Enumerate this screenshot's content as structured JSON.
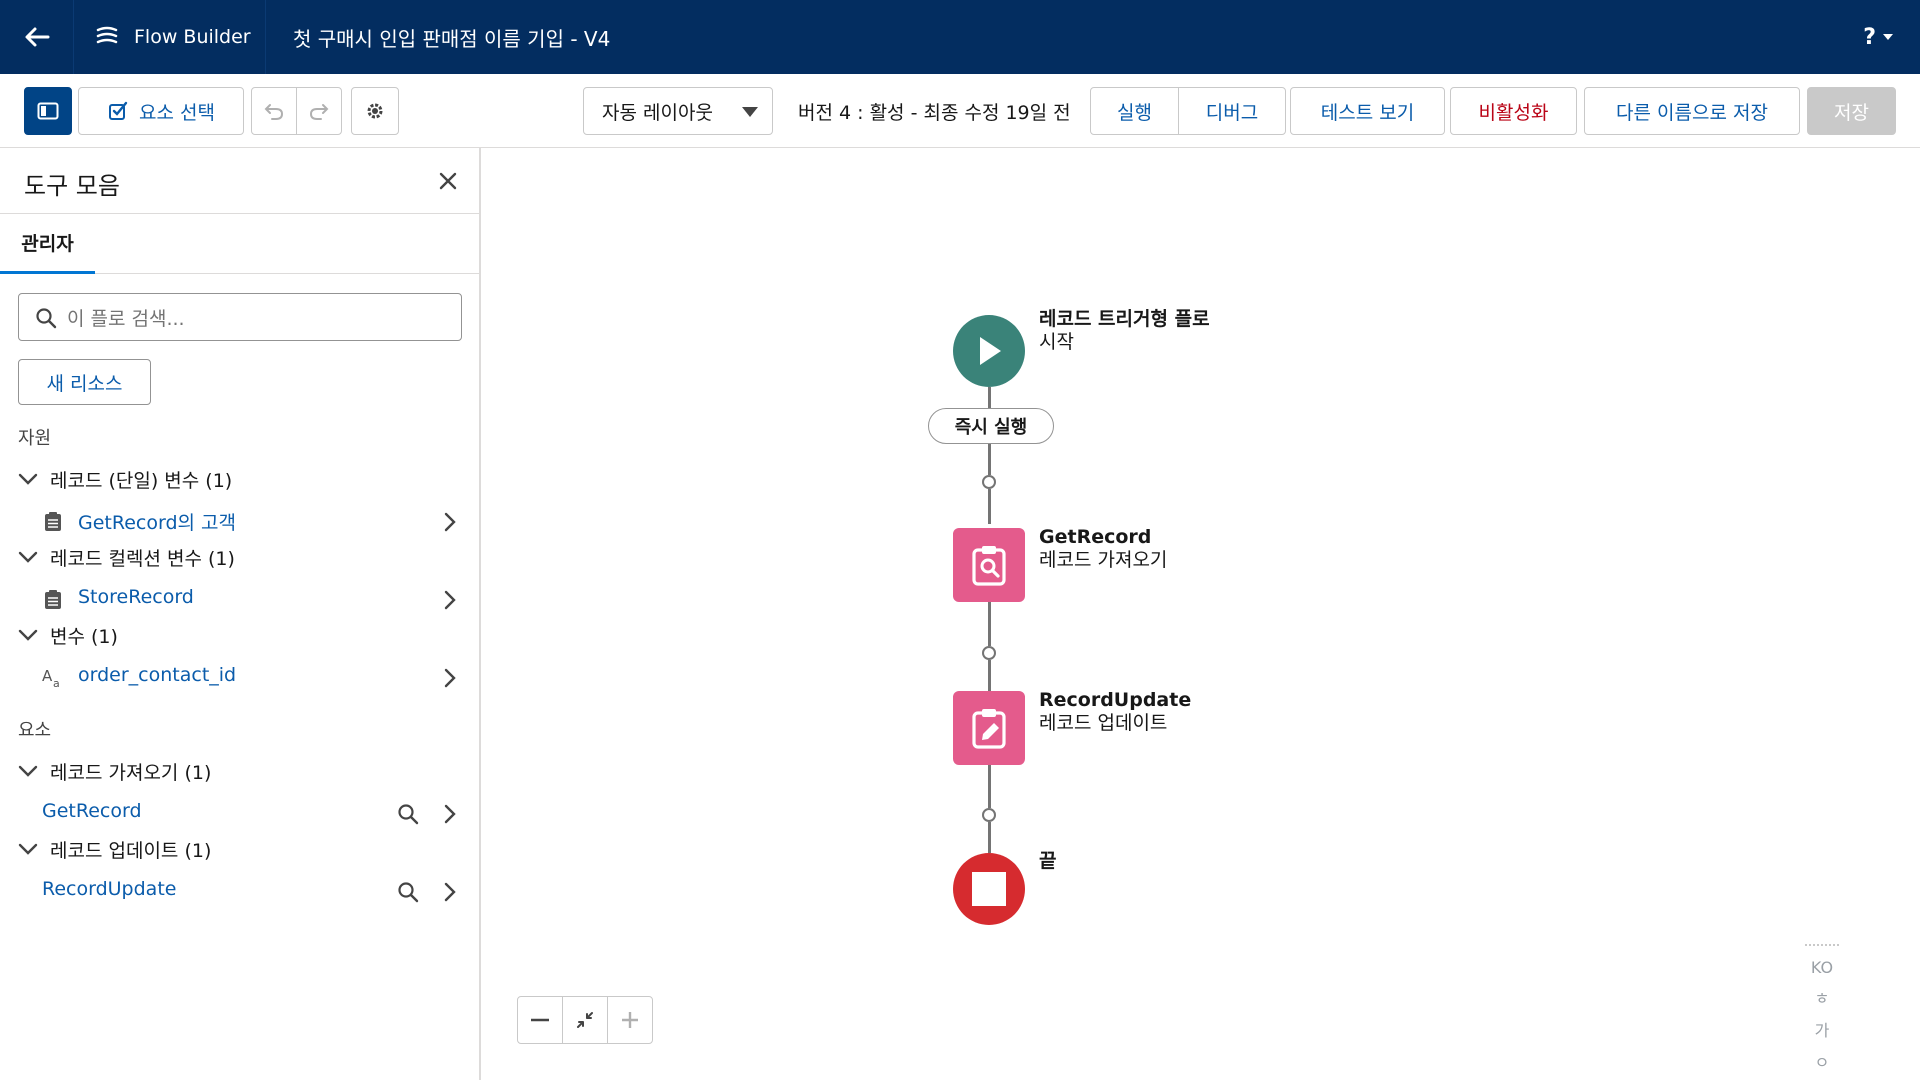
{
  "header": {
    "app_name": "Flow Builder",
    "flow_title": "첫 구매시 인입 판매점 이름 기입 - V4",
    "help_label": "?"
  },
  "toolbar": {
    "select_elements_label": "요소 선택",
    "layout_select_value": "자동 레이아웃",
    "version_text": "버전 4 : 활성 - 최종 수정 19일 전",
    "run_label": "실행",
    "debug_label": "디버그",
    "test_view_label": "테스트 보기",
    "deactivate_label": "비활성화",
    "save_as_label": "다른 이름으로 저장",
    "save_label": "저장"
  },
  "panel": {
    "title": "도구 모음",
    "tab_manager": "관리자",
    "search_placeholder": "이 플로 검색...",
    "new_resource_label": "새 리소스",
    "resources_section": "자원",
    "elements_section": "요소",
    "resource_groups": [
      {
        "label": "레코드 (단일) 변수 (1)",
        "items": [
          "GetRecord의 고객"
        ]
      },
      {
        "label": "레코드 컬렉션 변수 (1)",
        "items": [
          "StoreRecord"
        ]
      },
      {
        "label": "변수 (1)",
        "items": [
          "order_contact_id"
        ]
      }
    ],
    "element_groups": [
      {
        "label": "레코드 가져오기 (1)",
        "items": [
          "GetRecord"
        ]
      },
      {
        "label": "레코드 업데이트 (1)",
        "items": [
          "RecordUpdate"
        ]
      }
    ]
  },
  "canvas": {
    "start_title": "레코드 트리거형 플로",
    "start_subtitle": "시작",
    "run_immediately": "즉시 실행",
    "get_record_title": "GetRecord",
    "get_record_subtitle": "레코드 가져오기",
    "update_record_title": "RecordUpdate",
    "update_record_subtitle": "레코드 업데이트",
    "end_title": "끝"
  },
  "lang_widget": {
    "lines": [
      "KO",
      "ㅎ",
      "가",
      "ㅇ"
    ]
  },
  "colors": {
    "header_bg": "#032d60",
    "brand_blue": "#0b5cab",
    "start_node": "#3a8379",
    "record_node": "#e45b8c",
    "end_node": "#d62b2f",
    "deactivate_text": "#ba0517"
  }
}
